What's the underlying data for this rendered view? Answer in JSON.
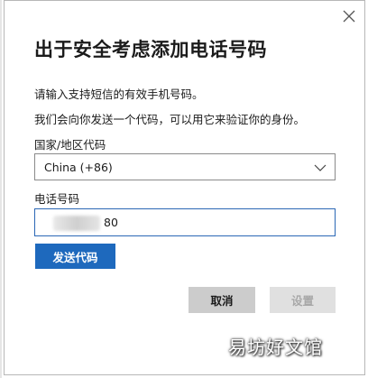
{
  "dialog": {
    "title": "出于安全考虑添加电话号码",
    "description_line1": "请输入支持短信的有效手机号码。",
    "description_line2": "我们会向你发送一个代码，可以用它来验证你的身份。",
    "close_icon": "close-icon"
  },
  "form": {
    "country_label": "国家/地区代码",
    "country_value": "China (+86)",
    "phone_label": "电话号码",
    "phone_value_visible": "80"
  },
  "buttons": {
    "send_code": "发送代码",
    "cancel": "取消",
    "settings": "设置"
  },
  "watermark": {
    "text": "易坊好文馆"
  },
  "colors": {
    "primary": "#1e69bd",
    "input_focus_border": "#2b67b5",
    "secondary_button": "#cccccc",
    "disabled_button": "#e0e0e0",
    "disabled_text": "#a8a8a8"
  }
}
